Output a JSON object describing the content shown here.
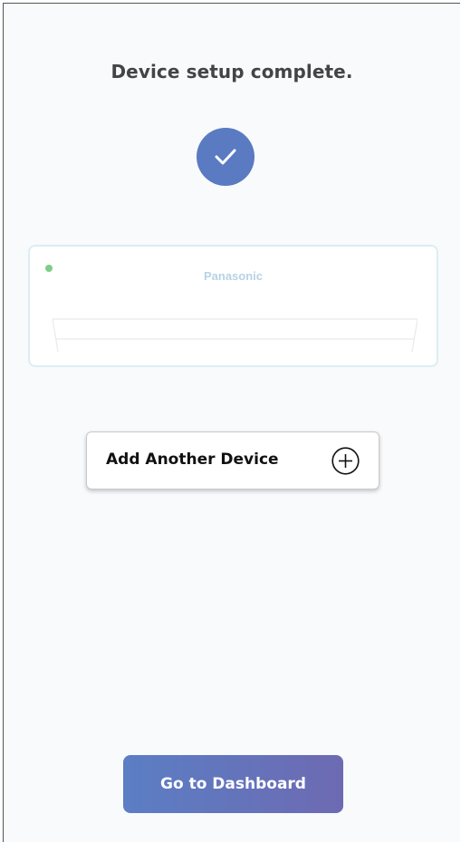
{
  "setup": {
    "title": "Device setup complete."
  },
  "device": {
    "brand": "Panasonic",
    "status_color": "#7fce87",
    "icon": "air-conditioner-icon"
  },
  "actions": {
    "add_device_label": "Add Another Device",
    "add_device_icon": "plus-circle-icon",
    "dashboard_label": "Go to Dashboard"
  },
  "colors": {
    "accent": "#5a7bc2",
    "gradient_start": "#5b7ec4",
    "gradient_end": "#6d6ab2"
  }
}
